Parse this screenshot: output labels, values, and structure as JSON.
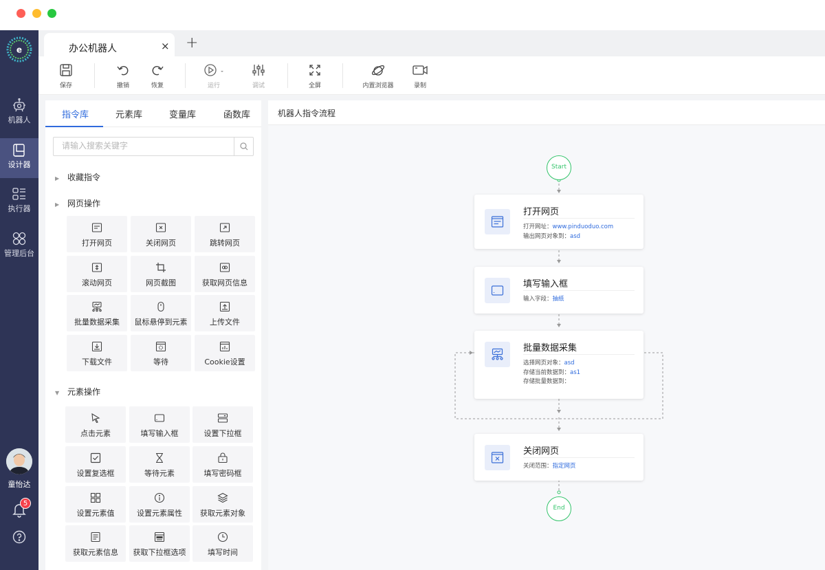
{
  "window": {
    "controls": [
      "close",
      "minimize",
      "maximize"
    ]
  },
  "sidebar": {
    "logo": "app-logo",
    "items": [
      {
        "label": "机器人",
        "icon": "robot-icon"
      },
      {
        "label": "设计器",
        "icon": "designer-icon",
        "active": true
      },
      {
        "label": "执行器",
        "icon": "executor-icon"
      },
      {
        "label": "管理后台",
        "icon": "admin-icon"
      }
    ],
    "user": {
      "name": "童怡达"
    },
    "notifications": {
      "count": "5"
    },
    "help_icon": "help-icon"
  },
  "tabs": {
    "items": [
      {
        "label": "办公机器人",
        "close": "×"
      }
    ],
    "add": "+"
  },
  "toolbar": {
    "items": [
      {
        "label": "保存",
        "icon": "save-icon"
      },
      {
        "label": "撤销",
        "icon": "undo-icon"
      },
      {
        "label": "恢复",
        "icon": "redo-icon"
      },
      {
        "label": "运行",
        "icon": "run-icon"
      },
      {
        "label": "调试",
        "icon": "debug-icon"
      },
      {
        "label": "全屏",
        "icon": "fullscreen-icon"
      },
      {
        "label": "内置浏览器",
        "icon": "browser-icon"
      },
      {
        "label": "录制",
        "icon": "record-icon"
      }
    ]
  },
  "library": {
    "tabs": [
      "指令库",
      "元素库",
      "变量库",
      "函数库"
    ],
    "active_tab": "指令库",
    "search_placeholder": "请输入搜索关键字",
    "categories": {
      "favorites": "收藏指令",
      "web": "网页操作",
      "element": "元素操作"
    },
    "web_items": [
      "打开网页",
      "关闭网页",
      "跳转网页",
      "滚动网页",
      "网页截图",
      "获取网页信息",
      "批量数据采集",
      "鼠标悬停到元素",
      "上传文件",
      "下载文件",
      "等待",
      "Cookie设置"
    ],
    "element_items": [
      "点击元素",
      "填写输入框",
      "设置下拉框",
      "设置复选框",
      "等待元素",
      "填写密码框",
      "设置元素值",
      "设置元素属性",
      "获取元素对象",
      "获取元素信息",
      "获取下拉框选项",
      "填写时间"
    ]
  },
  "flow": {
    "title": "机器人指令流程",
    "start": "Start",
    "end": "End",
    "nodes": [
      {
        "title": "打开网页",
        "props": [
          {
            "k": "打开网址：",
            "v": "www.pinduoduo.com"
          },
          {
            "k": "输出网页对象到：",
            "v": "asd"
          }
        ]
      },
      {
        "title": "填写输入框",
        "props": [
          {
            "k": "输入字段：",
            "v": "抽纸"
          }
        ]
      },
      {
        "title": "批量数据采集",
        "props": [
          {
            "k": "选择网页对象：",
            "v": "asd"
          },
          {
            "k": "存储当前数据到：",
            "v": "as1"
          },
          {
            "k": "存储批量数据到：",
            "v": ""
          }
        ]
      },
      {
        "title": "关闭网页",
        "props": [
          {
            "k": "关闭范围：",
            "v": "指定网页"
          }
        ]
      }
    ]
  },
  "colors": {
    "sidebar_bg": "#2e3456",
    "accent": "#2f6bdd",
    "terminal_green": "#34c46b",
    "badge_red": "#f5404a"
  }
}
